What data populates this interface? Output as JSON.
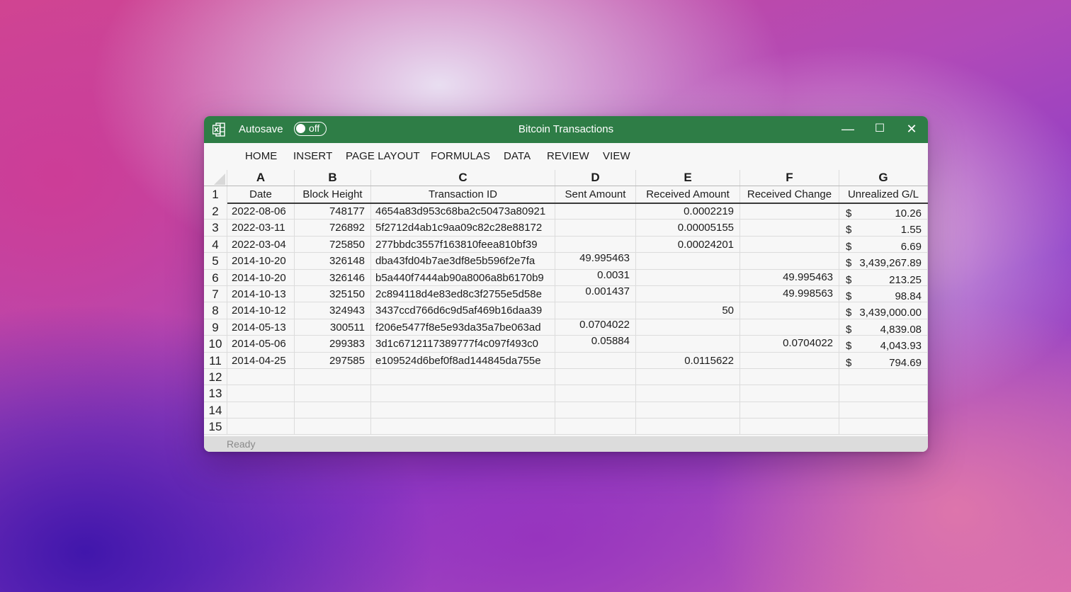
{
  "window": {
    "title": "Bitcoin Transactions",
    "autosave_label": "Autosave",
    "autosave_state": "off",
    "accent_color": "#2e7d46",
    "controls": {
      "minimize": "—",
      "maximize": "☐",
      "close": "✕"
    }
  },
  "menu": [
    "HOME",
    "INSERT",
    "PAGE LAYOUT",
    "FORMULAS",
    "DATA",
    "REVIEW",
    "VIEW"
  ],
  "columns": [
    "A",
    "B",
    "C",
    "D",
    "E",
    "F",
    "G"
  ],
  "headers": [
    "Date",
    "Block Height",
    "Transaction ID",
    "Sent Amount",
    "Received Amount",
    "Received Change",
    "Unrealized G/L"
  ],
  "row_numbers": [
    "1",
    "2",
    "3",
    "4",
    "5",
    "6",
    "7",
    "8",
    "9",
    "10",
    "11",
    "12",
    "13",
    "14",
    "15"
  ],
  "rows": [
    {
      "date": "2022-08-06",
      "block": "748177",
      "txid": "4654a83d953c68ba2c50473a80921",
      "sent": "",
      "received": "0.0002219",
      "change": "",
      "gl_symbol": "$",
      "gl": "10.26"
    },
    {
      "date": "2022-03-11",
      "block": "726892",
      "txid": "5f2712d4ab1c9aa09c82c28e88172",
      "sent": "",
      "received": "0.00005155",
      "change": "",
      "gl_symbol": "$",
      "gl": "1.55"
    },
    {
      "date": "2022-03-04",
      "block": "725850",
      "txid": "277bbdc3557f163810feea810bf39",
      "sent": "",
      "received": "0.00024201",
      "change": "",
      "gl_symbol": "$",
      "gl": "6.69"
    },
    {
      "date": "2014-10-20",
      "block": "326148",
      "txid": "dba43fd04b7ae3df8e5b596f2e7fa",
      "sent": "49.995463",
      "received": "",
      "change": "",
      "gl_symbol": "$",
      "gl": "3,439,267.89"
    },
    {
      "date": "2014-10-20",
      "block": "326146",
      "txid": "b5a440f7444ab90a8006a8b6170b9",
      "sent": "0.0031",
      "received": "",
      "change": "49.995463",
      "gl_symbol": "$",
      "gl": "213.25"
    },
    {
      "date": "2014-10-13",
      "block": "325150",
      "txid": "2c894118d4e83ed8c3f2755e5d58e",
      "sent": "0.001437",
      "received": "",
      "change": "49.998563",
      "gl_symbol": "$",
      "gl": "98.84"
    },
    {
      "date": "2014-10-12",
      "block": "324943",
      "txid": "3437ccd766d6c9d5af469b16daa39",
      "sent": "",
      "received": "50",
      "change": "",
      "gl_symbol": "$",
      "gl": "3,439,000.00"
    },
    {
      "date": "2014-05-13",
      "block": "300511",
      "txid": "f206e5477f8e5e93da35a7be063ad",
      "sent": "0.0704022",
      "received": "",
      "change": "",
      "gl_symbol": "$",
      "gl": "4,839.08"
    },
    {
      "date": "2014-05-06",
      "block": "299383",
      "txid": "3d1c6712117389777f4c097f493c0",
      "sent": "0.05884",
      "received": "",
      "change": "0.0704022",
      "gl_symbol": "$",
      "gl": "4,043.93"
    },
    {
      "date": "2014-04-25",
      "block": "297585",
      "txid": "e109524d6bef0f8ad144845da755e",
      "sent": "",
      "received": "0.0115622",
      "change": "",
      "gl_symbol": "$",
      "gl": "794.69"
    }
  ],
  "status": "Ready"
}
